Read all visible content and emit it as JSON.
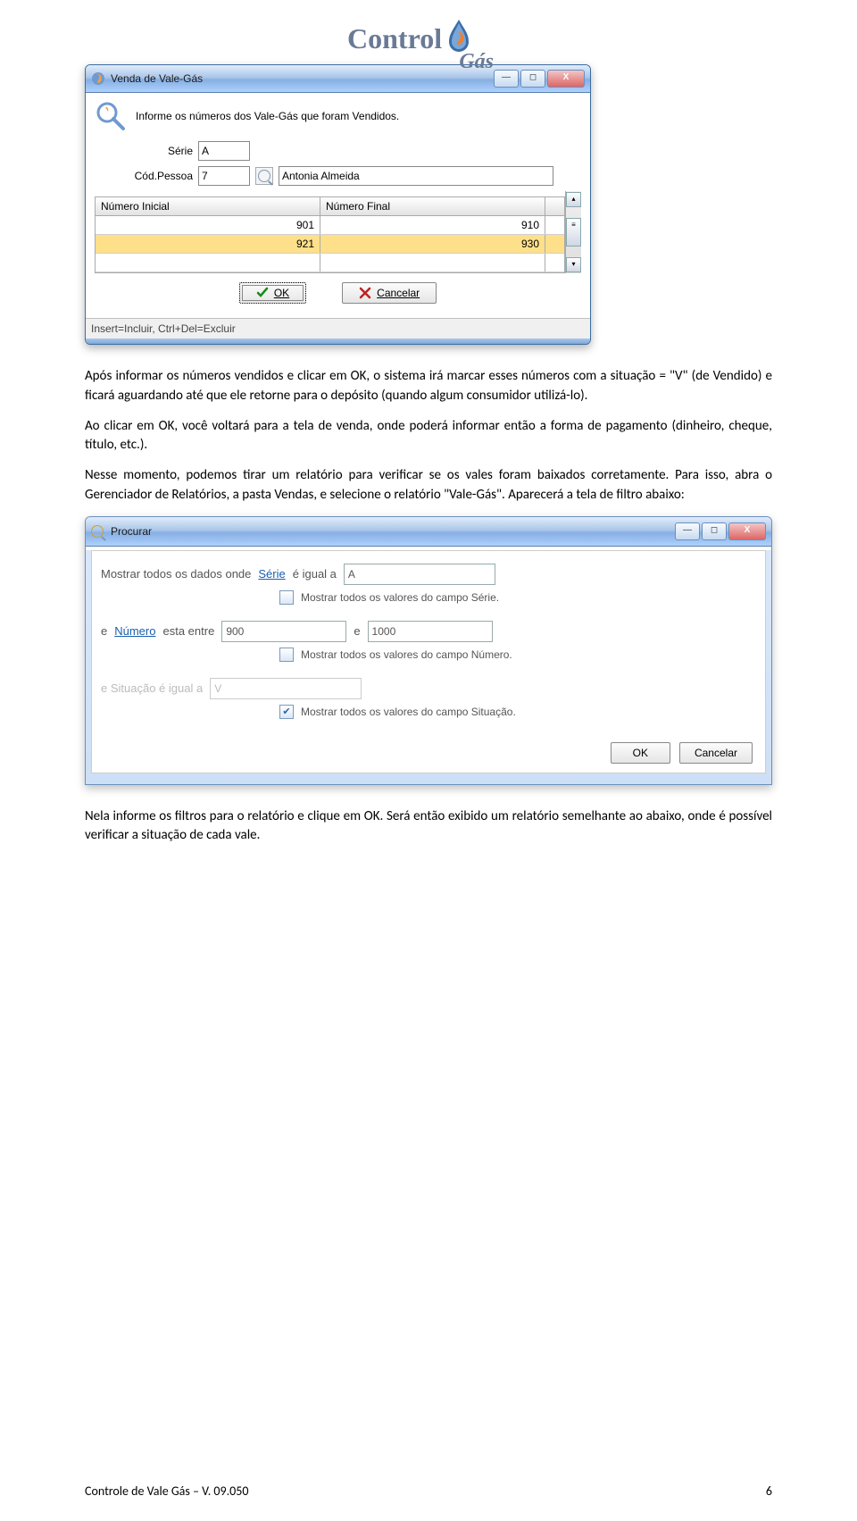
{
  "logo": {
    "line1": "Control",
    "line2": "Gás"
  },
  "win1": {
    "title": "Venda de Vale-Gás",
    "info": "Informe os números dos Vale-Gás que foram Vendidos.",
    "serie_label": "Série",
    "serie_value": "A",
    "cod_label": "Cód.Pessoa",
    "cod_value": "7",
    "pessoa_nome": "Antonia Almeida",
    "col_ini": "Número Inicial",
    "col_fim": "Número Final",
    "rows": [
      {
        "ini": "901",
        "fim": "910"
      },
      {
        "ini": "921",
        "fim": "930"
      }
    ],
    "ok": "OK",
    "cancel": "Cancelar",
    "status": "Insert=Incluir, Ctrl+Del=Excluir"
  },
  "p1": "Após informar os números vendidos e clicar em OK, o sistema irá marcar esses números com a situação = \"V\" (de Vendido) e ficará aguardando até que ele retorne para o depósito (quando algum consumidor utilizá-lo).",
  "p2": "Ao clicar em OK, você voltará para a tela de venda, onde poderá informar então a forma de pagamento (dinheiro, cheque, título, etc.).",
  "p3": "Nesse momento, podemos tirar um relatório para verificar se os vales foram baixados corretamente. Para isso, abra o Gerenciador de Relatórios, a pasta Vendas, e selecione o relatório \"Vale-Gás\". Aparecerá a tela de filtro abaixo:",
  "win2": {
    "procurar_label": "Procurar",
    "l1_pre": "Mostrar todos os dados onde ",
    "l1_field": "Série",
    "l1_mid": "  é igual a",
    "l1_val": "A",
    "l1_chk_label": "Mostrar todos os valores do campo Série.",
    "l2_pre": "e ",
    "l2_field": "Número",
    "l2_mid": "  esta entre",
    "l2_v1": "900",
    "l2_e": "e",
    "l2_v2": "1000",
    "l2_chk_label": "Mostrar todos os valores do campo Número.",
    "l3_pre": "e Situação é igual a",
    "l3_val": "V",
    "l3_chk_label": "Mostrar todos os valores do campo Situação.",
    "ok": "OK",
    "cancel": "Cancelar"
  },
  "p4": "Nela informe os filtros para o relatório e clique em OK. Será então exibido um relatório semelhante ao abaixo, onde é possível verificar a situação de cada vale.",
  "footer_left": "Controle de Vale Gás – V. 09.050",
  "footer_right": "6"
}
